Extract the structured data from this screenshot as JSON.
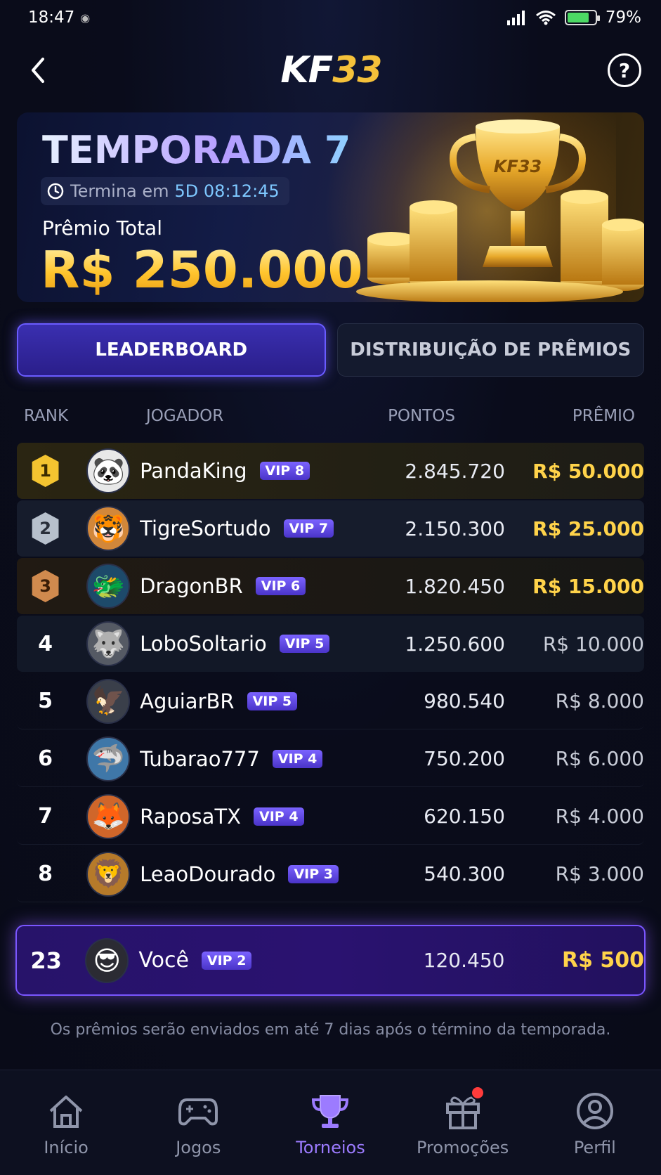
{
  "status": {
    "time": "18:47",
    "battery": "79%",
    "battery_level": 0.79
  },
  "header": {
    "logo_left": "KF",
    "logo_right": "33"
  },
  "banner": {
    "season": "TEMPORADA 7",
    "ends_label": "Termina em",
    "ends_value": "5D 08:12:45",
    "prize_label": "Prêmio Total",
    "prize_value": "R$ 250.000",
    "trophy_text": "KF33"
  },
  "tabs": [
    {
      "label": "LEADERBOARD"
    },
    {
      "label": "DISTRIBUIÇÃO DE PRÊMIOS"
    }
  ],
  "table": {
    "headers": {
      "rank": "RANK",
      "player": "JOGADOR",
      "points": "PONTOS",
      "prize": "PRÊMIO"
    },
    "rows": [
      {
        "rank": "1",
        "name": "PandaKing",
        "vip": "VIP 8",
        "points": "2.845.720",
        "prize": "R$ 50.000",
        "avatar": "🐼"
      },
      {
        "rank": "2",
        "name": "TigreSortudo",
        "vip": "VIP 7",
        "points": "2.150.300",
        "prize": "R$ 25.000",
        "avatar": "🐯"
      },
      {
        "rank": "3",
        "name": "DragonBR",
        "vip": "VIP 6",
        "points": "1.820.450",
        "prize": "R$ 15.000",
        "avatar": "🐲"
      },
      {
        "rank": "4",
        "name": "LoboSoltario",
        "vip": "VIP 5",
        "points": "1.250.600",
        "prize": "R$ 10.000",
        "avatar": "🐺"
      },
      {
        "rank": "5",
        "name": "AguiarBR",
        "vip": "VIP 5",
        "points": "980.540",
        "prize": "R$ 8.000",
        "avatar": "🦅"
      },
      {
        "rank": "6",
        "name": "Tubarao777",
        "vip": "VIP 4",
        "points": "750.200",
        "prize": "R$ 6.000",
        "avatar": "🦈"
      },
      {
        "rank": "7",
        "name": "RaposaTX",
        "vip": "VIP 4",
        "points": "620.150",
        "prize": "R$ 4.000",
        "avatar": "🦊"
      },
      {
        "rank": "8",
        "name": "LeaoDourado",
        "vip": "VIP 3",
        "points": "540.300",
        "prize": "R$ 3.000",
        "avatar": "🦁"
      }
    ]
  },
  "you": {
    "rank": "23",
    "name": "Você",
    "vip": "VIP 2",
    "points": "120.450",
    "prize": "R$ 500",
    "avatar": "😎"
  },
  "note": "Os prêmios serão enviados em até 7 dias após o término da temporada.",
  "nav": [
    {
      "label": "Início",
      "icon": "home-icon"
    },
    {
      "label": "Jogos",
      "icon": "gamepad-icon"
    },
    {
      "label": "Torneios",
      "icon": "trophy-icon"
    },
    {
      "label": "Promoções",
      "icon": "gift-icon"
    },
    {
      "label": "Perfil",
      "icon": "user-icon"
    }
  ],
  "colors": {
    "accent": "#7a56ff",
    "gold": "#ffd34a",
    "background": "#0a0c1b"
  }
}
